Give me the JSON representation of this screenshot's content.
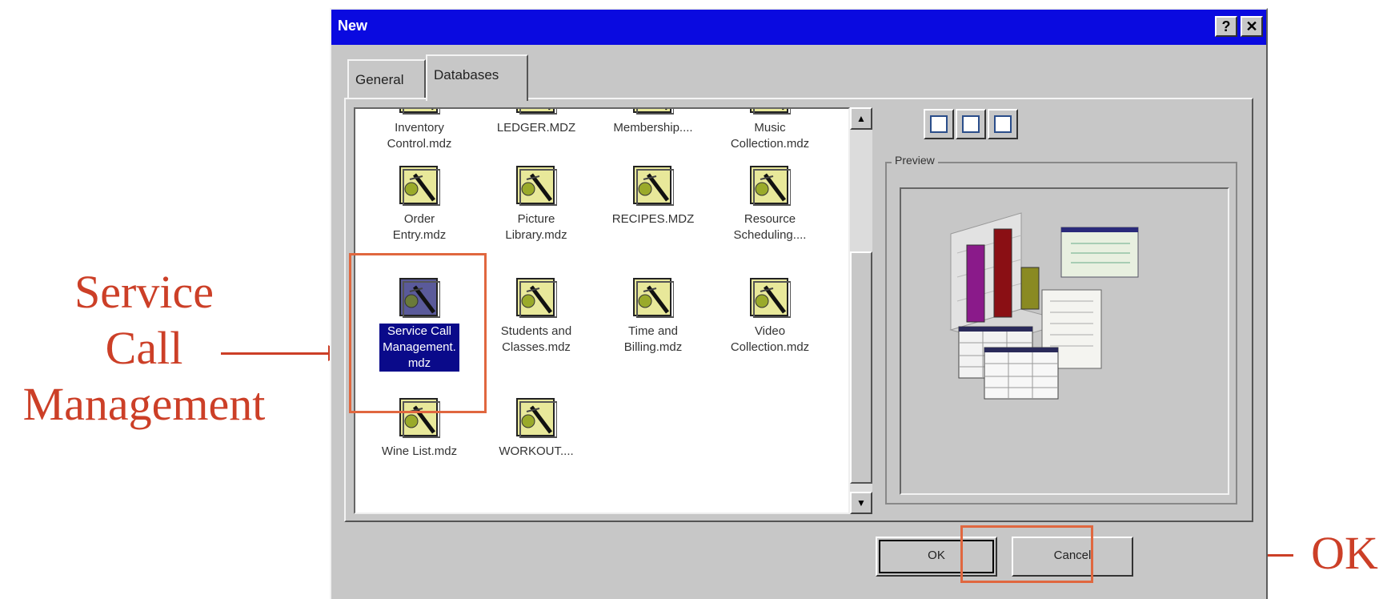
{
  "dialog": {
    "title": "New",
    "help_button": "?",
    "close_button": "✕",
    "tabs": [
      {
        "label": "General",
        "active": false
      },
      {
        "label": "Databases",
        "active": true
      }
    ],
    "preview_label": "Preview",
    "ok_label": "OK",
    "cancel_label": "Cancel"
  },
  "files": [
    {
      "label": "Inventory\nControl.mdz",
      "icon": "database-wizard-icon",
      "selected": false
    },
    {
      "label": "LEDGER.MDZ",
      "icon": "database-wizard-icon",
      "selected": false
    },
    {
      "label": "Membership....",
      "icon": "database-wizard-icon",
      "selected": false
    },
    {
      "label": "Music\nCollection.mdz",
      "icon": "database-wizard-icon",
      "selected": false
    },
    {
      "label": "Order\nEntry.mdz",
      "icon": "database-wizard-icon",
      "selected": false
    },
    {
      "label": "Picture\nLibrary.mdz",
      "icon": "database-wizard-icon",
      "selected": false
    },
    {
      "label": "RECIPES.MDZ",
      "icon": "database-wizard-icon",
      "selected": false
    },
    {
      "label": "Resource\nScheduling....",
      "icon": "database-wizard-icon",
      "selected": false
    },
    {
      "label": "Service Call\nManagement.\nmdz",
      "icon": "database-wizard-icon",
      "selected": true
    },
    {
      "label": "Students and\nClasses.mdz",
      "icon": "database-wizard-icon",
      "selected": false
    },
    {
      "label": "Time and\nBilling.mdz",
      "icon": "database-wizard-icon",
      "selected": false
    },
    {
      "label": "Video\nCollection.mdz",
      "icon": "database-wizard-icon",
      "selected": false
    },
    {
      "label": "Wine List.mdz",
      "icon": "database-wizard-icon",
      "selected": false
    },
    {
      "label": "WORKOUT....",
      "icon": "database-wizard-icon",
      "selected": false
    }
  ],
  "annotations": {
    "service_call": [
      "Service",
      "Call",
      "Management"
    ],
    "ok": "OK"
  },
  "colors": {
    "titlebar": "#0a0ae0",
    "selection": "#0a0a8a",
    "annotation": "#cc3f27",
    "dialog_face": "#c7c7c7"
  }
}
